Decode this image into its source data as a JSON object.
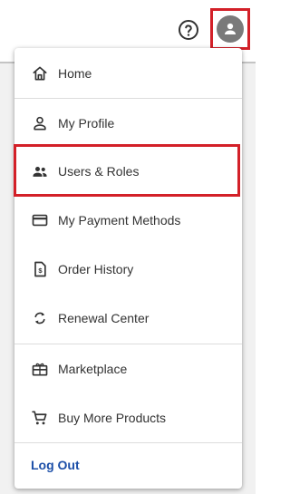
{
  "header": {
    "help_icon": "help-circle-icon",
    "avatar_icon": "person-icon"
  },
  "menu": {
    "items": [
      {
        "label": "Home",
        "icon": "home-icon"
      },
      {
        "label": "My Profile",
        "icon": "person-outline-icon"
      },
      {
        "label": "Users & Roles",
        "icon": "people-icon"
      },
      {
        "label": "My Payment Methods",
        "icon": "credit-card-icon"
      },
      {
        "label": "Order History",
        "icon": "receipt-icon"
      },
      {
        "label": "Renewal Center",
        "icon": "refresh-icon"
      },
      {
        "label": "Marketplace",
        "icon": "gift-icon"
      },
      {
        "label": "Buy More Products",
        "icon": "cart-icon"
      }
    ],
    "logout_label": "Log Out"
  },
  "colors": {
    "highlight": "#d32028",
    "link": "#1c4fa8",
    "avatar": "#7a7a7a",
    "text": "#333333"
  }
}
